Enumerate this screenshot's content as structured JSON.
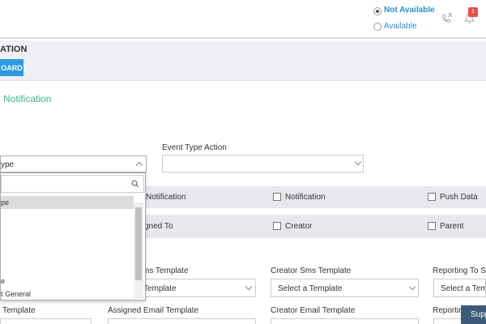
{
  "header": {
    "status_options": [
      {
        "label": "Not Available",
        "selected": true
      },
      {
        "label": "Available",
        "selected": false
      }
    ],
    "notification_count": "1"
  },
  "subbar": {
    "title": "ATION",
    "button_label": "OARD"
  },
  "page": {
    "section_title": "Notification"
  },
  "form": {
    "event_type_value": "ype",
    "event_type_action_label": "Event Type Action",
    "checkbox_row1": [
      "Notification",
      "Notification",
      "Push Data"
    ],
    "checkbox_row2": [
      "gned To",
      "Creator",
      "Parent"
    ],
    "template_labels_row1": [
      "ms Template",
      "Creator Sms Template",
      "Reporting To Sr"
    ],
    "template_values_row1": [
      "Template",
      "Select a Template",
      "Select a Temp"
    ],
    "template_labels_row2": [
      "Template",
      "Assigned Email Template",
      "Creator Email Template",
      "Reportin"
    ]
  },
  "dropdown": {
    "items": [
      "pe",
      "e",
      "t General"
    ]
  },
  "support_label": "Supp",
  "colors": {
    "accent_blue": "#2a9be0",
    "accent_green": "#3cb58f",
    "badge_red": "#e84c4c"
  }
}
